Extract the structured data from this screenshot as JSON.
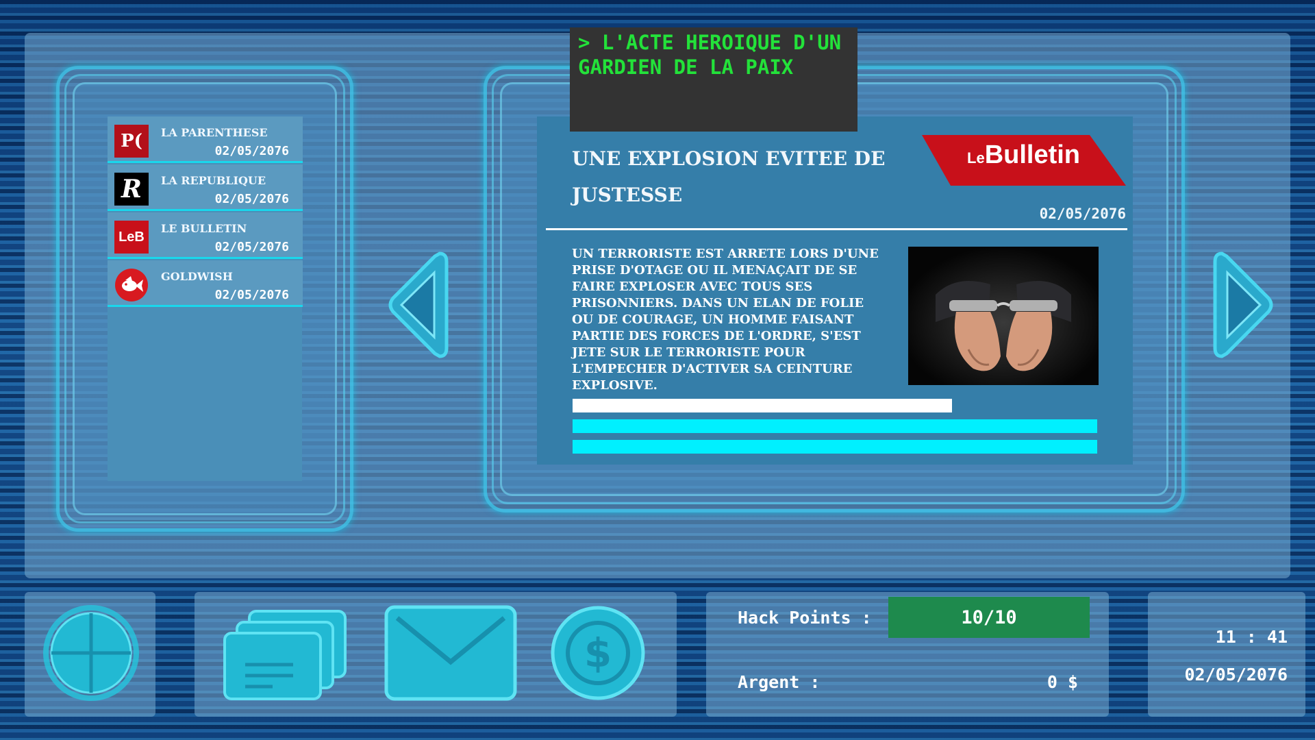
{
  "headline_banner": "> L'ACTE HEROIQUE D'UN GARDIEN DE LA PAIX",
  "newspapers": [
    {
      "name": "LA PARENTHESE",
      "date": "02/05/2076",
      "logo_text": "P(",
      "logo_color": "#b3101a"
    },
    {
      "name": "LA REPUBLIQUE",
      "date": "02/05/2076",
      "logo_text": "R",
      "logo_color": "#000000"
    },
    {
      "name": "LE BULLETIN",
      "date": "02/05/2076",
      "logo_text": "LeB",
      "logo_color": "#c8101a"
    },
    {
      "name": "GOLDWISH",
      "date": "02/05/2076",
      "logo_text": "",
      "logo_color": "#d81a20"
    }
  ],
  "article": {
    "title": "UNE EXPLOSION EVITEE DE JUSTESSE",
    "brand_prefix": "Le",
    "brand_name": "Bulletin",
    "date": "02/05/2076",
    "body": "UN TERRORISTE EST ARRETE LORS D'UNE PRISE D'OTAGE OU IL MENAÇAIT DE SE FAIRE EXPLOSER AVEC TOUS SES PRISONNIERS. DANS UN ELAN DE FOLIE OU DE COURAGE, UN HOMME FAISANT PARTIE DES FORCES DE L'ORDRE, S'EST JETE SUR LE TERRORISTE POUR L'EMPECHER D'ACTIVER SA CEINTURE EXPLOSIVE.",
    "photo_icon": "handcuffs-photo"
  },
  "status": {
    "hack_label": "Hack Points :",
    "hack_value": "10/10",
    "money_label": "Argent :",
    "money_value": "0 $",
    "time": "11 : 41",
    "date": "02/05/2076"
  },
  "colors": {
    "accent_cyan": "#00f0ff",
    "headline_green": "#23e23a",
    "hack_green": "#1e8a4d",
    "brand_red": "#c8101a"
  }
}
